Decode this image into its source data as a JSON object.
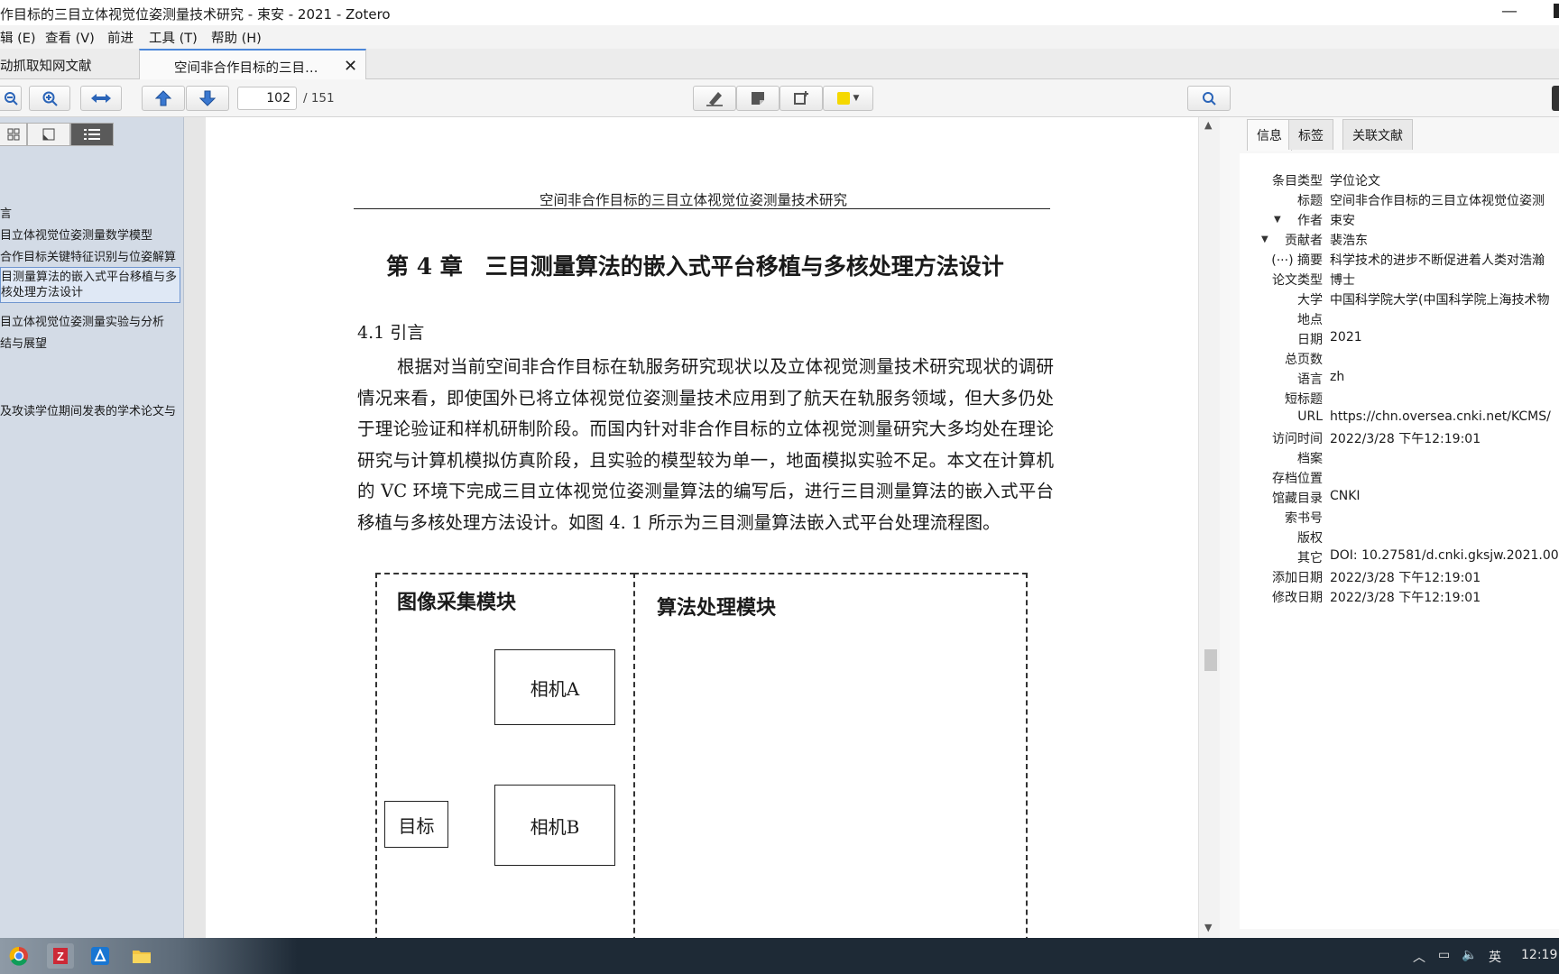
{
  "window": {
    "title": "作目标的三目立体视觉位姿测量技术研究 - 束安 - 2021 - Zotero",
    "minimize_glyph": "—"
  },
  "menu": {
    "edit": "辑 (E)",
    "view": "查看 (V)",
    "forward": "前进",
    "tools": "工具 (T)",
    "help": "帮助 (H)"
  },
  "tabs": [
    {
      "label": "动抓取知网文献"
    },
    {
      "label": "空间非合作目标的三目…",
      "close": "✕"
    }
  ],
  "toolbar": {
    "page_current": "102",
    "page_total": "/ 151"
  },
  "sidebar": {
    "outline": [
      "言",
      "目立体视觉位姿测量数学模型",
      "合作目标关键特征识别与位姿解算",
      "目测量算法的嵌入式平台移植与多核处理方法设计",
      "目立体视觉位姿测量实验与分析",
      "结与展望",
      "及攻读学位期间发表的学术论文与"
    ]
  },
  "document": {
    "running_head": "空间非合作目标的三目立体视觉位姿测量技术研究",
    "chapter_title": "第 4 章　三目测量算法的嵌入式平台移植与多核处理方法设计",
    "section_title": "4.1  引言",
    "paragraph": "根据对当前空间非合作目标在轨服务研究现状以及立体视觉测量技术研究现状的调研情况来看，即使国外已将立体视觉位姿测量技术应用到了航天在轨服务领域，但大多仍处于理论验证和样机研制阶段。而国内针对非合作目标的立体视觉测量研究大多均处在理论研究与计算机模拟仿真阶段，且实验的模型较为单一，地面模拟实验不足。本文在计算机的 VC 环境下完成三目立体视觉位姿测量算法的编写后，进行三目测量算法的嵌入式平台移植与多核处理方法设计。如图 4. 1 所示为三目测量算法嵌入式平台处理流程图。",
    "figure": {
      "module_left": "图像采集模块",
      "module_right": "算法处理模块",
      "camera_a": "相机A",
      "camera_b": "相机B",
      "target": "目标"
    }
  },
  "info_pane": {
    "tabs": [
      "信息",
      "标签",
      "关联文献"
    ],
    "fields": [
      {
        "label": "条目类型",
        "value": "学位论文"
      },
      {
        "label": "标题",
        "value": "空间非合作目标的三目立体视觉位姿测"
      },
      {
        "label": "作者",
        "value": "束安"
      },
      {
        "label": "贡献者",
        "value": "裴浩东"
      },
      {
        "label": "(···) 摘要",
        "value": "科学技术的进步不断促进着人类对浩瀚"
      },
      {
        "label": "论文类型",
        "value": "博士"
      },
      {
        "label": "大学",
        "value": "中国科学院大学(中国科学院上海技术物"
      },
      {
        "label": "地点",
        "value": ""
      },
      {
        "label": "日期",
        "value": "2021"
      },
      {
        "label": "总页数",
        "value": ""
      },
      {
        "label": "语言",
        "value": "zh"
      },
      {
        "label": "短标题",
        "value": ""
      },
      {
        "label": "URL",
        "value": "https://chn.oversea.cnki.net/KCMS/"
      },
      {
        "label": "访问时间",
        "value": "2022/3/28 下午12:19:01"
      },
      {
        "label": "档案",
        "value": ""
      },
      {
        "label": "存档位置",
        "value": ""
      },
      {
        "label": "馆藏目录",
        "value": "CNKI"
      },
      {
        "label": "索书号",
        "value": ""
      },
      {
        "label": "版权",
        "value": ""
      },
      {
        "label": "其它",
        "value": "DOI: 10.27581/d.cnki.gksjw.2021.00"
      },
      {
        "label": "添加日期",
        "value": "2022/3/28 下午12:19:01"
      },
      {
        "label": "修改日期",
        "value": "2022/3/28 下午12:19:01"
      }
    ]
  },
  "taskbar": {
    "ime": "英",
    "clock": "12:19"
  },
  "colors": {
    "accent": "#4a86d9",
    "sidebar_bg": "#d3dbe6",
    "taskbar_bg": "#1e2a36",
    "highlight_swatch": "#f5d800"
  }
}
